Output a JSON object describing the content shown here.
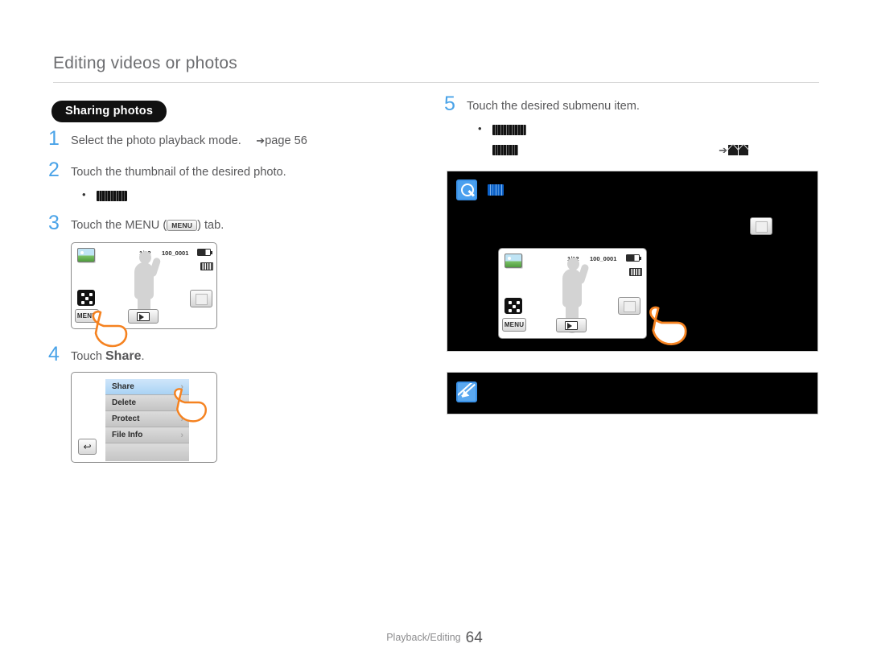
{
  "header": {
    "title": "Editing videos or photos",
    "section_badge": "Sharing photos"
  },
  "left_column": {
    "steps": [
      {
        "num": "1",
        "text": "Select the photo playback mode.",
        "ref_arrow": "➔",
        "ref": "page 56"
      },
      {
        "num": "2",
        "text": "Touch the thumbnail of the desired photo.",
        "bullet_redacted_width": 38
      },
      {
        "num": "3",
        "text_before": "Touch the MENU (",
        "chip": "MENU",
        "text_after": ") tab."
      },
      {
        "num": "4",
        "text_before": "Touch ",
        "bold": "Share",
        "text_after": "."
      }
    ],
    "lcd": {
      "counter": "1/12",
      "file_name": "100_0001",
      "menu_label": "MENU",
      "photo_icon": "photo-mode-icon",
      "thumbnail_icon": "thumbnail-view-icon",
      "play_icon": "slideshow-play-icon",
      "battery_icon": "battery-icon",
      "storage_icon": "storage-card-icon"
    },
    "popup_menu": {
      "items": [
        {
          "label": "Share",
          "has_chevron": true,
          "selected": true
        },
        {
          "label": "Delete",
          "has_chevron": false,
          "selected": false
        },
        {
          "label": "Protect",
          "has_chevron": true,
          "selected": false
        },
        {
          "label": "File Info",
          "has_chevron": true,
          "selected": false
        }
      ],
      "back_label": "↩"
    }
  },
  "right_column": {
    "step": {
      "num": "5",
      "text": "Touch the desired submenu item.",
      "bullet_redacted_width": 42,
      "sub_redacted_width": 32,
      "ref_arrow": "➔"
    },
    "info_panel": {
      "icon": "magnifier-icon",
      "title_redacted_width": 20,
      "lcd": {
        "counter": "1/12",
        "file_name": "100_0001",
        "menu_label": "MENU"
      }
    },
    "note_panel": {
      "icon": "note-pen-icon"
    }
  },
  "footer": {
    "section": "Playback/Editing",
    "page": "64"
  },
  "colors": {
    "step_number": "#4aa3e8",
    "body_text": "#58585a",
    "badge_bg": "#111111",
    "panel_bg": "#000000",
    "accent_blue": "#4aa0ef",
    "hand_orange": "#f58220",
    "menu_selected": "#a9d2f4"
  }
}
